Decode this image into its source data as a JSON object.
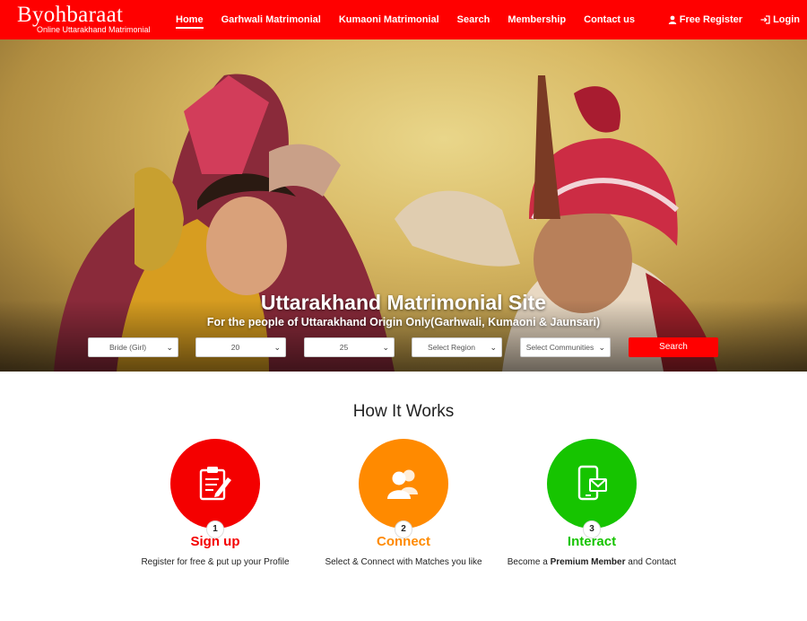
{
  "brand": {
    "name": "Byohbaraat",
    "tagline": "Online Uttarakhand Matrimonial"
  },
  "nav": {
    "items": [
      {
        "label": "Home"
      },
      {
        "label": "Garhwali Matrimonial"
      },
      {
        "label": "Kumaoni Matrimonial"
      },
      {
        "label": "Search"
      },
      {
        "label": "Membership"
      },
      {
        "label": "Contact us"
      }
    ],
    "free_register": "Free Register",
    "login": "Login"
  },
  "hero": {
    "title": "Uttarakhand Matrimonial Site",
    "subtitle": "For the people of Uttarakhand Origin Only(Garhwali, Kumaoni & Jaunsari)"
  },
  "search": {
    "looking_for": "Bride (Girl)",
    "age_from": "20",
    "age_to": "25",
    "region": "Select Region",
    "community": "Select Communities",
    "button": "Search"
  },
  "how_it_works": {
    "title": "How It Works",
    "steps": [
      {
        "number": "1",
        "title": "Sign up",
        "desc": "Register for free & put up your Profile",
        "color": "#f40000",
        "icon": "form-icon"
      },
      {
        "number": "2",
        "title": "Connect",
        "desc": "Select & Connect with Matches you like",
        "color": "#ff8a00",
        "icon": "users-icon"
      },
      {
        "number": "3",
        "title": "Interact",
        "desc_pre": "Become a ",
        "desc_bold": "Premium Member",
        "desc_post": " and Contact",
        "color": "#16c400",
        "icon": "mobile-message-icon"
      }
    ]
  },
  "colors": {
    "primary": "#ff0000",
    "signup": "#f40000",
    "connect": "#ff8a00",
    "interact": "#16c400"
  }
}
